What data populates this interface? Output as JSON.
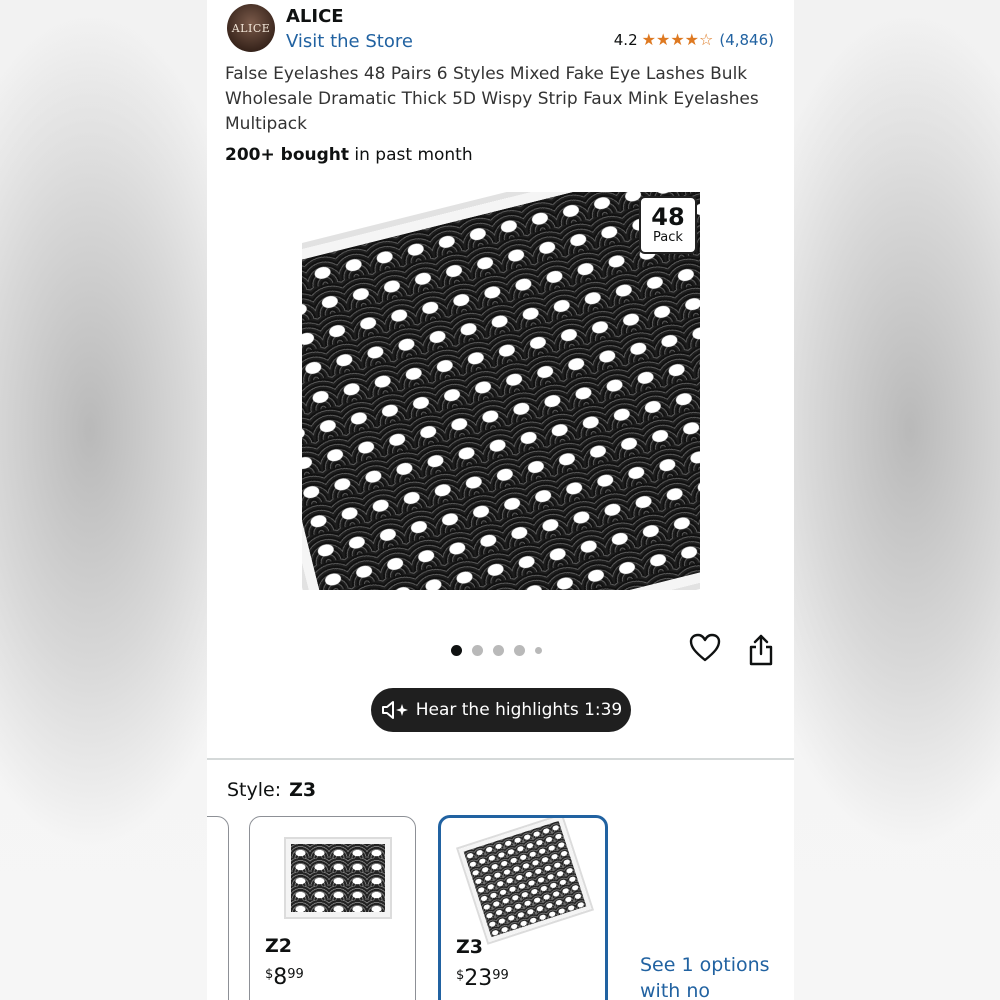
{
  "seller": {
    "avatar_text": "ALICE",
    "name": "ALICE",
    "visit_store": "Visit the Store",
    "rating": "4.2",
    "rating_value": 4.2,
    "stars": "★★★★☆",
    "review_count": "(4,846)"
  },
  "product": {
    "title": "False Eyelashes 48 Pairs 6 Styles Mixed Fake Eye Lashes Bulk Wholesale Dramatic Thick 5D Wispy Strip Faux Mink Eyelashes Multipack",
    "bought_bold": "200+ bought",
    "bought_rest": " in past month",
    "pack_number": "48",
    "pack_word": "Pack"
  },
  "gallery": {
    "image_count": 5,
    "active_index": 0
  },
  "audio": {
    "label": "Hear the highlights 1:39"
  },
  "style": {
    "label": "Style:",
    "selected": "Z3",
    "options": [
      {
        "name": "Z2",
        "price_symbol": "$",
        "price_whole": "8",
        "price_cents": "99"
      },
      {
        "name": "Z3",
        "price_symbol": "$",
        "price_whole": "23",
        "price_cents": "99"
      }
    ],
    "see_options": "See 1 options with no"
  },
  "colors": {
    "link": "#2162a1",
    "star": "#de7921",
    "selected_border": "#2162a1",
    "dark_button": "#1f1f1f"
  },
  "icons": [
    "heart-icon",
    "share-icon",
    "speaker-sparkle-icon"
  ]
}
